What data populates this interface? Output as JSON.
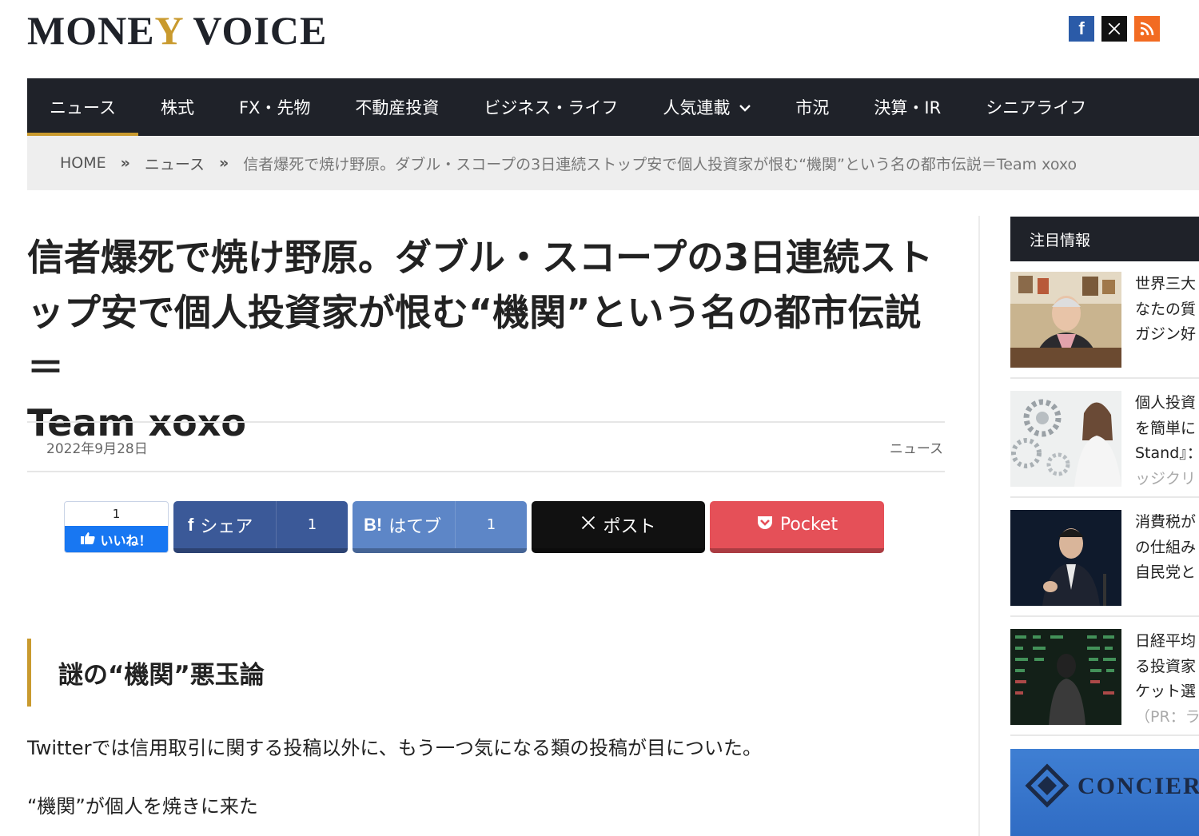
{
  "header": {
    "logo_part1": "MONE",
    "logo_y": "Y",
    "logo_part2": " VOICE",
    "social": [
      {
        "name": "facebook-icon",
        "glyph": "f",
        "color": "#2b5ba8"
      },
      {
        "name": "x-icon",
        "glyph": "𝕏",
        "color": "#111111"
      },
      {
        "name": "rss-icon",
        "glyph": "))",
        "color": "#f26b22"
      }
    ]
  },
  "nav": {
    "items": [
      {
        "label": "ニュース"
      },
      {
        "label": "株式"
      },
      {
        "label": "FX・先物"
      },
      {
        "label": "不動産投資"
      },
      {
        "label": "ビジネス・ライフ"
      },
      {
        "label": "人気連載"
      },
      {
        "label": "市況"
      },
      {
        "label": "決算・IR"
      },
      {
        "label": "シニアライフ"
      }
    ],
    "active_index": 0
  },
  "breadcrumb": {
    "home": "HOME",
    "sep": "»",
    "category": "ニュース",
    "current": "信者爆死で焼け野原。ダブル・スコープの3日連続ストップ安で個人投資家が恨む“機関”という名の都市伝説＝Team xoxo"
  },
  "article": {
    "title_line1": "信者爆死で焼け野原。ダブル・スコープの3日連続スト",
    "title_line2": "ップ安で個人投資家が恨む“機関”という名の都市伝説＝",
    "title_line3": "Team xoxo",
    "date": "2022年9月28日",
    "category": "ニュース",
    "heading": "謎の“機関”悪玉論",
    "paragraph1": "Twitterでは信用取引に関する投稿以外に、もう一つ気になる類の投稿が目についた。",
    "paragraph2": "“機関”が個人を焼きに来た"
  },
  "share": {
    "like_count": "1",
    "like_label": "いいね！",
    "facebook_label": "シェア",
    "facebook_count": "1",
    "hatena_prefix": "B!",
    "hatena_label": "はてブ",
    "hatena_count": "1",
    "x_label": "ポスト",
    "pocket_label": "Pocket"
  },
  "sidebar": {
    "title": "注目情報",
    "items": [
      {
        "lines": [
          "世界三大",
          "なたの質",
          "ガジン好"
        ],
        "pr": ""
      },
      {
        "lines": [
          "個人投資",
          "を簡単に",
          "Stand』："
        ],
        "pr": "ッジクリ"
      },
      {
        "lines": [
          "消費税が",
          "の仕組み",
          "自民党と"
        ],
        "pr": ""
      },
      {
        "lines": [
          "日経平均",
          "る投資家",
          "ケット選"
        ],
        "pr": "（PR：ラ"
      }
    ],
    "banner_text": "CONCIER"
  }
}
